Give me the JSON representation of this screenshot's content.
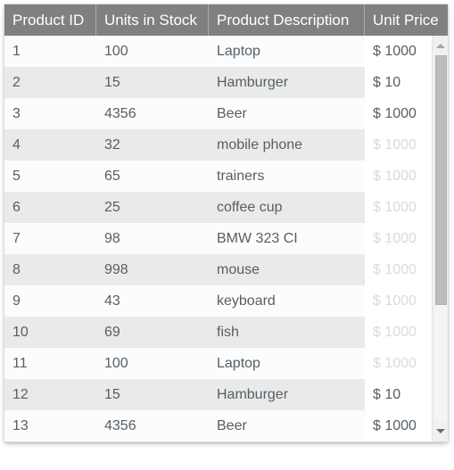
{
  "grid": {
    "columns": [
      {
        "key": "product_id",
        "label": "Product ID"
      },
      {
        "key": "units_in_stock",
        "label": "Units in Stock"
      },
      {
        "key": "product_description",
        "label": "Product Description"
      },
      {
        "key": "unit_price",
        "label": "Unit Price"
      }
    ],
    "rows": [
      {
        "product_id": "1",
        "units_in_stock": "100",
        "product_description": "Laptop",
        "unit_price": "$ 1000",
        "price_faded": false
      },
      {
        "product_id": "2",
        "units_in_stock": "15",
        "product_description": "Hamburger",
        "unit_price": "$ 10",
        "price_faded": false
      },
      {
        "product_id": "3",
        "units_in_stock": "4356",
        "product_description": "Beer",
        "unit_price": "$ 1000",
        "price_faded": false
      },
      {
        "product_id": "4",
        "units_in_stock": "32",
        "product_description": "mobile phone",
        "unit_price": "$ 1000",
        "price_faded": true
      },
      {
        "product_id": "5",
        "units_in_stock": "65",
        "product_description": "trainers",
        "unit_price": "$ 1000",
        "price_faded": true
      },
      {
        "product_id": "6",
        "units_in_stock": "25",
        "product_description": "coffee cup",
        "unit_price": "$ 1000",
        "price_faded": true
      },
      {
        "product_id": "7",
        "units_in_stock": "98",
        "product_description": "BMW 323 CI",
        "unit_price": "$ 1000",
        "price_faded": true
      },
      {
        "product_id": "8",
        "units_in_stock": "998",
        "product_description": "mouse",
        "unit_price": "$ 1000",
        "price_faded": true
      },
      {
        "product_id": "9",
        "units_in_stock": "43",
        "product_description": "keyboard",
        "unit_price": "$ 1000",
        "price_faded": true
      },
      {
        "product_id": "10",
        "units_in_stock": "69",
        "product_description": "fish",
        "unit_price": "$ 1000",
        "price_faded": true
      },
      {
        "product_id": "11",
        "units_in_stock": "100",
        "product_description": "Laptop",
        "unit_price": "$ 1000",
        "price_faded": true
      },
      {
        "product_id": "12",
        "units_in_stock": "15",
        "product_description": "Hamburger",
        "unit_price": "$ 10",
        "price_faded": false
      },
      {
        "product_id": "13",
        "units_in_stock": "4356",
        "product_description": "Beer",
        "unit_price": "$ 1000",
        "price_faded": false
      }
    ],
    "colors": {
      "header_background": "#808080",
      "header_text": "#ffffff",
      "row_background": "#fcfcfc",
      "row_alt_background": "#eaeaea",
      "cell_text": "#555f66",
      "faded_price_text": "#dadada"
    }
  },
  "scrollbar": {
    "up_arrow": "scroll-up-arrow",
    "down_arrow": "scroll-down-arrow",
    "thumb": "scroll-thumb"
  }
}
